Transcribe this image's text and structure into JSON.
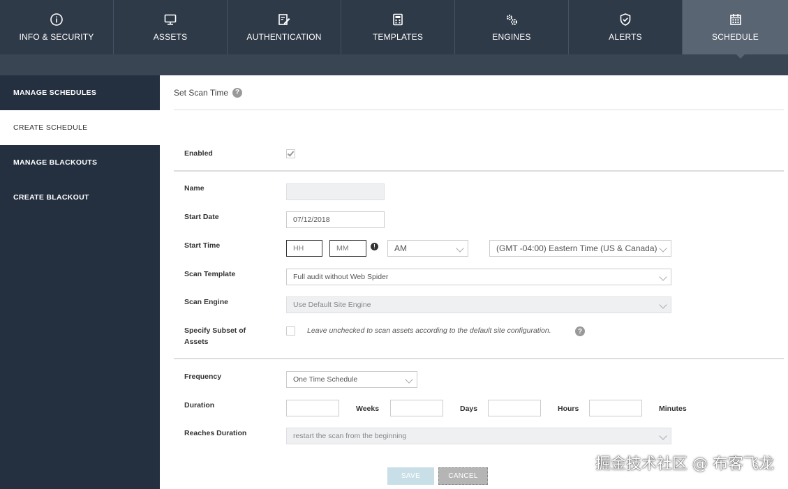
{
  "nav": {
    "tabs": [
      {
        "label": "INFO & SECURITY",
        "icon": "info-icon"
      },
      {
        "label": "ASSETS",
        "icon": "monitor-icon"
      },
      {
        "label": "AUTHENTICATION",
        "icon": "edit-icon"
      },
      {
        "label": "TEMPLATES",
        "icon": "calculator-icon"
      },
      {
        "label": "ENGINES",
        "icon": "gears-icon"
      },
      {
        "label": "ALERTS",
        "icon": "shield-icon"
      },
      {
        "label": "SCHEDULE",
        "icon": "calendar-icon"
      }
    ],
    "active": "SCHEDULE"
  },
  "sidebar": {
    "items": [
      {
        "label": "MANAGE SCHEDULES"
      },
      {
        "label": "CREATE SCHEDULE"
      },
      {
        "label": "MANAGE BLACKOUTS"
      },
      {
        "label": "CREATE BLACKOUT"
      }
    ],
    "active": "CREATE SCHEDULE"
  },
  "form": {
    "section_title": "Set Scan Time",
    "help_glyph": "?",
    "enabled_label": "Enabled",
    "enabled_checked": true,
    "name_label": "Name",
    "name_value": "",
    "start_date_label": "Start Date",
    "start_date_value": "07/12/2018",
    "start_time_label": "Start Time",
    "hour_placeholder": "HH",
    "minute_placeholder": "MM",
    "ampm_value": "AM",
    "timezone_value": "(GMT -04:00) Eastern Time (US & Canada)",
    "scan_template_label": "Scan Template",
    "scan_template_value": "Full audit without Web Spider",
    "scan_engine_label": "Scan Engine",
    "scan_engine_value": "Use Default Site Engine",
    "subset_label_1": "Specify Subset of",
    "subset_label_2": "Assets",
    "subset_hint": "Leave unchecked to scan assets according to the default site configuration.",
    "frequency_label": "Frequency",
    "frequency_value": "One Time Schedule",
    "duration_label": "Duration",
    "weeks_label": "Weeks",
    "days_label": "Days",
    "hours_label": "Hours",
    "minutes_label": "Minutes",
    "reaches_label": "Reaches Duration",
    "reaches_value": "restart the scan from the beginning",
    "save_label": "SAVE",
    "cancel_label": "CANCEL"
  },
  "watermark": "掘金技术社区 @ 布客飞龙"
}
